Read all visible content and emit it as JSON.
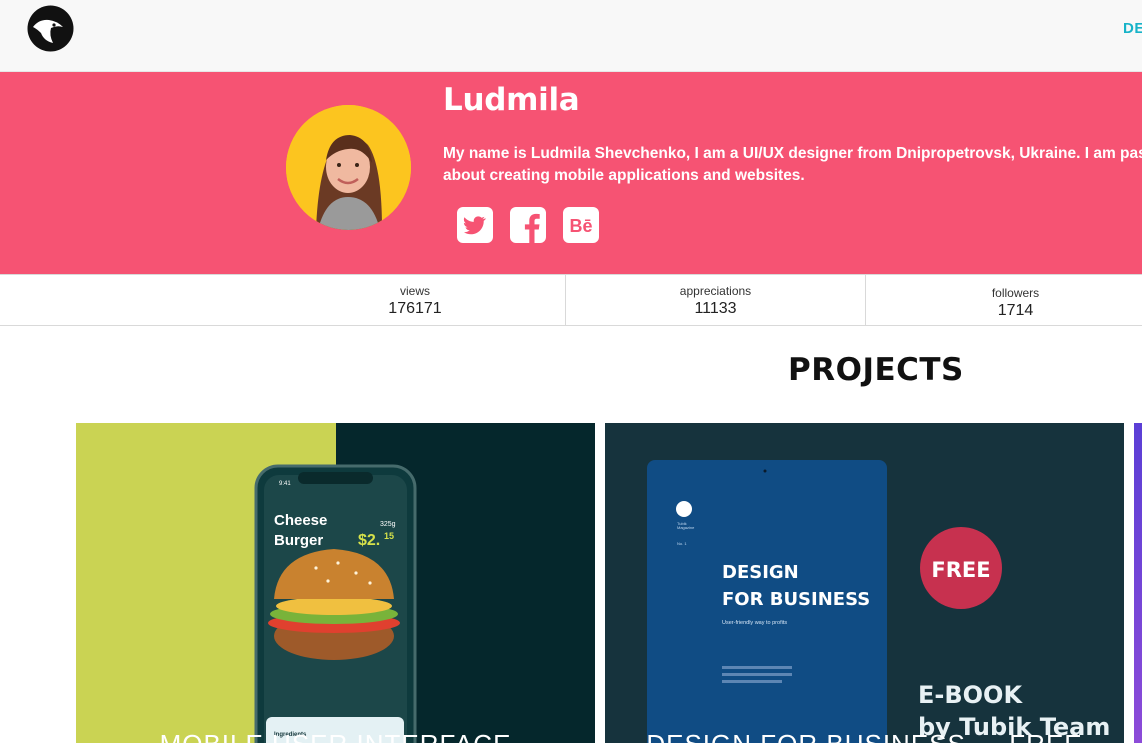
{
  "header": {
    "nav_link": "DE",
    "colors": {
      "background": "#f8f8f8",
      "accent": "#17b3c8"
    }
  },
  "profile": {
    "name": "Ludmila",
    "bio": "My name is Ludmila Shevchenko, I am a UI/UX designer from Dnipropetrovsk, Ukraine. I am passionate about creating mobile applications and websites.",
    "banner_color": "#f65373",
    "socials": [
      {
        "icon": "twitter-icon"
      },
      {
        "icon": "facebook-icon"
      },
      {
        "icon": "behance-icon",
        "label": "Bē"
      }
    ]
  },
  "stats": [
    {
      "label": "views",
      "value": "176171"
    },
    {
      "label": "appreciations",
      "value": "11133"
    },
    {
      "label": "followers",
      "value": "1714"
    }
  ],
  "projects": {
    "heading": "PROJECTS",
    "cards": [
      {
        "title": "MOBILE USER INTERFACE",
        "phone": {
          "time": "9:41",
          "dish_line1": "Cheese",
          "dish_line2": "Burger",
          "weight": "325g",
          "price": "$2.",
          "price_cents": "15",
          "section": "Ingredients"
        }
      },
      {
        "title": "DESIGN FOR BUSINESS — FREE",
        "book": {
          "brand_line1": "Tubik",
          "brand_line2": "Magazine",
          "issue": "No. 1",
          "title_line1": "DESIGN",
          "title_line2": "FOR BUSINESS",
          "subtitle": "User-friendly way to profits",
          "badge": "FREE",
          "promo_line1": "E-BOOK",
          "promo_line2": "by Tubik Team"
        }
      }
    ]
  }
}
